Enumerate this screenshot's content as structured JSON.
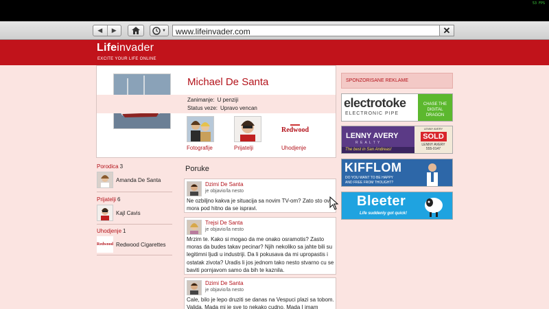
{
  "topbar": {
    "fps": "53 FPS"
  },
  "browser": {
    "back_icon": "back-arrow-icon",
    "forward_icon": "forward-arrow-icon",
    "url": "www.lifeinvader.com",
    "clear_icon": "close-icon"
  },
  "header": {
    "logo_bold": "Life",
    "logo_rest": "invader",
    "tagline": "EXCITE YOUR LIFE ONLINE",
    "brand_color": "#c1131b"
  },
  "profile": {
    "name": "Michael De Santa",
    "occupation_label": "Zanimanje:",
    "occupation_value": "U penziji",
    "relationship_label": "Status veze:",
    "relationship_value": "Upravo vencan",
    "tiles": [
      {
        "label": "Fotografije"
      },
      {
        "label": "Prijatelji"
      },
      {
        "label": "Uhodjenje",
        "logo": "Redwood"
      }
    ]
  },
  "sidebar": {
    "family_title": "Porodica",
    "family_count": "3",
    "family_item": "Amanda De Santa",
    "friends_title": "Prijatelji",
    "friends_count": "6",
    "friends_item": "Kajl Cavis",
    "stalking_title": "Uhodjenje",
    "stalking_count": "1",
    "stalking_item": "Redwood Cigarettes",
    "stalking_logo": "Redwood"
  },
  "feed": {
    "title": "Poruke",
    "posts": [
      {
        "author": "Dzimi De Santa",
        "meta": "je objavio/la nesto",
        "text": "Ne ozbiljno kakva je situacija sa novim TV-om? Zato sto ovo mora pod hitno da se ispravi."
      },
      {
        "author": "Trejsi De Santa",
        "meta": "je objavio/la nesto",
        "text": "Mrzim te. Kako si mogao da me onako osramotis? Zasto moras da budes takav pecinar? Njih nekoliko sa jahte bili su legitimni ljudi u industriji. Da li pokusava da mi upropastis i ostatak zivota? Uradis li jos jednom tako nesto stvarno cu se baviti pornjavom samo da bih te kaznila."
      },
      {
        "author": "Dzimi De Santa",
        "meta": "je objavio/la nesto",
        "text": "Cale, bilo je lepo druziti se danas na Vespuci plazi sa tobom. Valida. Mada mi je sve to nekako cudno. Mada I imam strasne"
      }
    ]
  },
  "ads": {
    "title": "SPONZORISANE REKLAME",
    "electrotoke": {
      "name": "electrotoke",
      "sub": "ELECTRONIC PIPE",
      "slogan1": "CHASE THE",
      "slogan2": "DIGITAL DRAGON"
    },
    "lenny": {
      "name": "LENNY AVERY",
      "top": "LENNY AVERY",
      "realty": "R E A L T Y",
      "sold": "SOLD",
      "tag": "The best in San Andreas!",
      "phone": "555-0147"
    },
    "kifflom": {
      "name": "KIFFLOM",
      "line1": "DO YOU WANT TO BE HAPPY",
      "line2": "AND FREE FROM THOUGHT?"
    },
    "bleeter": {
      "name": "Bleeter",
      "slogan": "Life suddenly got quick!"
    }
  }
}
